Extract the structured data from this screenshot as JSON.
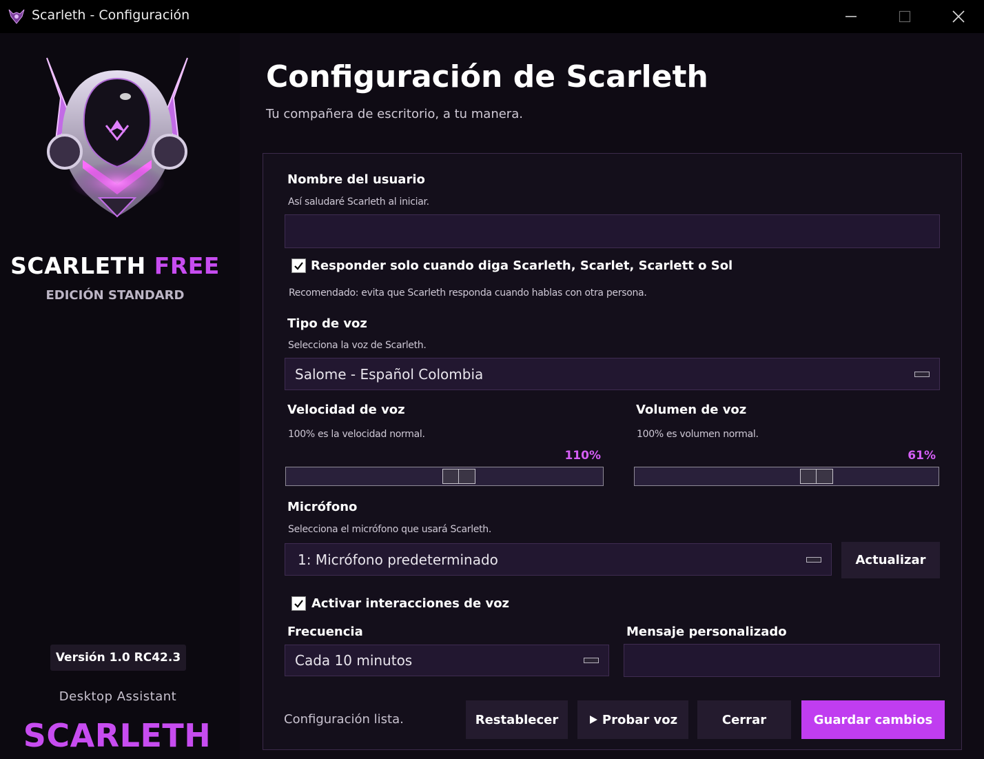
{
  "window": {
    "title": "Scarleth - Configuración",
    "controls": {
      "minimize": "—",
      "maximize": "☐",
      "close": "✕"
    }
  },
  "sidebar": {
    "brand_part1": "SCARLETH",
    "brand_part2": "FREE",
    "edition": "EDICIÓN STANDARD",
    "version": "Versión 1.0 RC42.3",
    "tagline": "Desktop Assistant",
    "brand_bottom": "SCARLETH",
    "logo_icon": "winged-helmet-logo"
  },
  "main": {
    "title": "Configuración de Scarleth",
    "subtitle": "Tu compañera de escritorio, a tu manera."
  },
  "form": {
    "username": {
      "label": "Nombre del usuario",
      "help": "Así saludaré Scarleth al iniciar.",
      "value": ""
    },
    "wake_word": {
      "checked": true,
      "label": "Responder solo cuando diga Scarleth, Scarlet, Scarlett o Sol",
      "help": "Recomendado: evita que Scarleth responda cuando hablas con otra persona."
    },
    "voice_type": {
      "label": "Tipo de voz",
      "help": "Selecciona la voz de Scarleth.",
      "selected": "Salome - Español Colombia"
    },
    "voice_speed": {
      "label": "Velocidad de voz",
      "help": "100% es la velocidad normal.",
      "value_text": "110%",
      "value_fraction": 0.55
    },
    "voice_volume": {
      "label": "Volumen de voz",
      "help": "100% es volumen normal.",
      "value_text": "61%",
      "value_fraction": 0.61
    },
    "microphone": {
      "label": "Micrófono",
      "help": "Selecciona el micrófono que usará Scarleth.",
      "selected": "1: Micrófono predeterminado",
      "refresh_label": "Actualizar"
    },
    "voice_interactions": {
      "checked": true,
      "label": "Activar interacciones de voz"
    },
    "frequency": {
      "label": "Frecuencia",
      "selected": "Cada 10 minutos"
    },
    "custom_message": {
      "label": "Mensaje personalizado",
      "value": ""
    }
  },
  "footer": {
    "status": "Configuración lista.",
    "reset_label": "Restablecer",
    "test_voice_label": "Probar voz",
    "test_voice_icon": "play-icon",
    "close_label": "Cerrar",
    "save_label": "Guardar cambios"
  },
  "colors": {
    "accent": "#c03df0",
    "accent_text": "#c74cf0",
    "percent_text": "#d45ef5",
    "background": "#0f0b14"
  }
}
